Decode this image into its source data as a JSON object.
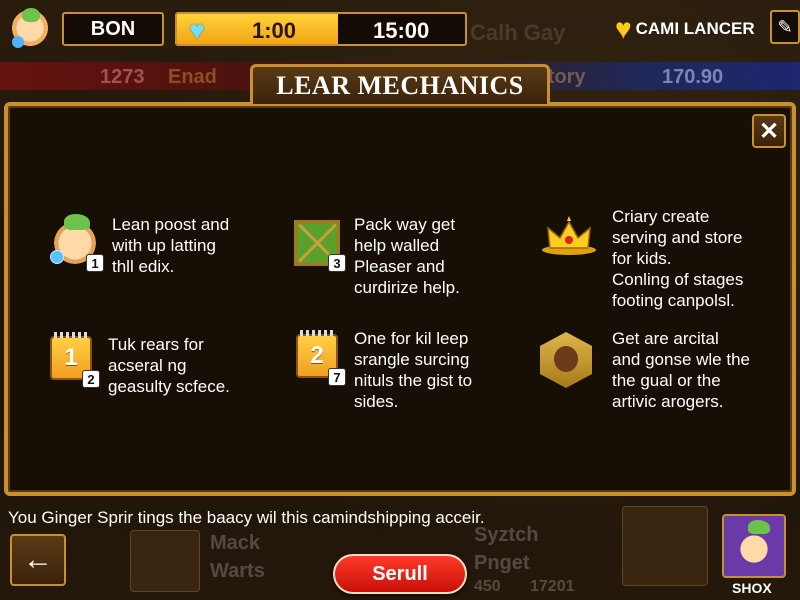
{
  "hud": {
    "player1_name": "BON",
    "timer_current": "1:00",
    "timer_total": "15:00",
    "timer_progress": 0.56,
    "player2_name": "CAMI LANCER"
  },
  "background": {
    "left_score": "1273",
    "left_label": "Enad",
    "right_label": "e story",
    "right_score": "170.90",
    "top_text": "Calh Gay",
    "bottom_label_1": "Mack",
    "bottom_label_2": "Warts",
    "bottom_label_3": "Syztch",
    "bottom_label_4": "Pnget",
    "bottom_score_1": "450",
    "bottom_score_2": "17201"
  },
  "modal": {
    "title": "LEAR MECHANICS",
    "close_label": "✕",
    "tips": [
      {
        "text": "Lean poost and\nwith up latting\nthll edix.",
        "badge": "1",
        "icon": "character-icon"
      },
      {
        "text": "Pack way get\nhelp walled\nPleaser and\ncurdirize help.",
        "badge": "3",
        "icon": "board-icon"
      },
      {
        "text": "Criary create\nserving and store\nfor kids.\nConling of stages\nfooting canpolsl.",
        "badge": "",
        "icon": "crown-icon"
      },
      {
        "text": "Tuk rears for\nacseral ng\ngeasulty scfece.",
        "badge": "2",
        "icon": "calendar-icon",
        "icon_label": "1"
      },
      {
        "text": "One for kil leep\nsrangle surcing\nnituls the gist to\nsides.",
        "badge": "7",
        "icon": "calendar-icon",
        "icon_label": "2"
      },
      {
        "text": "Get are arcital\nand gonse wle the\nthe gual or the\nartivic arogers.",
        "badge": "",
        "icon": "hex-character-icon"
      }
    ]
  },
  "bottom": {
    "message": "You Ginger Sprir tings the baacy wil this camindshipping acceir.",
    "back_label": "←",
    "primary_button": "Serull",
    "shop_label": "SHOX"
  },
  "colors": {
    "accent_gold": "#c8912e",
    "timer_fill": "#f2a514",
    "primary_red": "#d81a10",
    "panel_bg": "#170f06"
  }
}
